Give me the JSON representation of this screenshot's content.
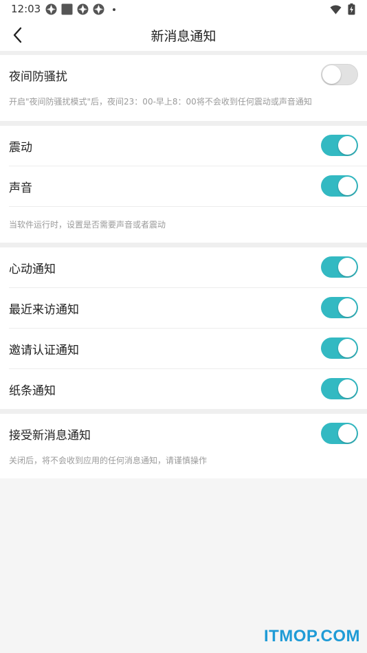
{
  "status_bar": {
    "time": "12:03",
    "icons": [
      "app-notification-icon",
      "square-notification-icon",
      "app-notification-icon",
      "app-notification-icon",
      "dot-icon"
    ],
    "right_icons": [
      "wifi-icon",
      "battery-charging-icon"
    ]
  },
  "header": {
    "title": "新消息通知"
  },
  "section1": {
    "night_mode_label": "夜间防骚扰",
    "night_mode_on": false,
    "night_mode_hint": "开启\"夜间防骚扰模式\"后，夜间23：00-早上8：00将不会收到任何震动或声音通知"
  },
  "section2": {
    "vibrate_label": "震动",
    "vibrate_on": true,
    "sound_label": "声音",
    "sound_on": true,
    "hint": "当软件运行时，设置是否需要声音或者震动"
  },
  "section3": {
    "items": [
      {
        "label": "心动通知",
        "on": true
      },
      {
        "label": "最近来访通知",
        "on": true
      },
      {
        "label": "邀请认证通知",
        "on": true
      },
      {
        "label": "纸条通知",
        "on": true
      }
    ]
  },
  "section4": {
    "receive_label": "接受新消息通知",
    "receive_on": true,
    "hint": "关闭后，将不会收到应用的任何消息通知，请谨慎操作"
  },
  "watermark": "ITMOP.COM",
  "colors": {
    "accent": "#33b9c2",
    "toggle_off": "#e2e2e2",
    "background": "#f5f5f5"
  }
}
